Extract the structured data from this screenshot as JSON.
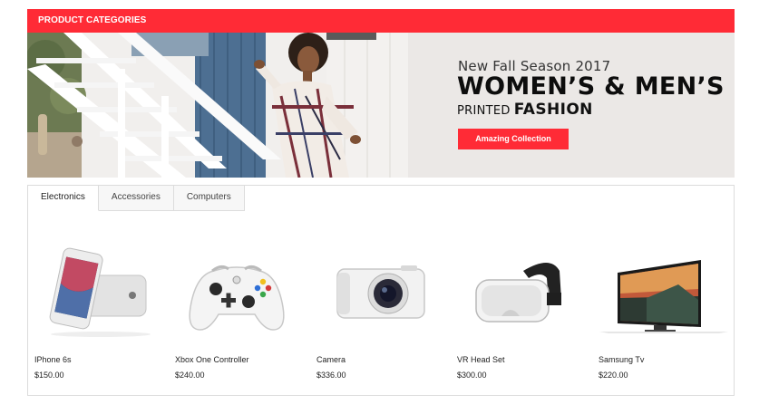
{
  "header": {
    "title": "PRODUCT CATEGORIES"
  },
  "banner": {
    "subtitle": "New Fall Season 2017",
    "title": "WOMEN’S & MEN’S",
    "printed": "PRINTED",
    "fashion": "FASHION",
    "cta_label": "Amazing Collection"
  },
  "tabs": [
    {
      "label": "Electronics",
      "active": true
    },
    {
      "label": "Accessories",
      "active": false
    },
    {
      "label": "Computers",
      "active": false
    }
  ],
  "products": [
    {
      "name": "IPhone 6s",
      "price": "$150.00",
      "icon": "phone-icon"
    },
    {
      "name": "Xbox One Controller",
      "price": "$240.00",
      "icon": "gamepad-icon"
    },
    {
      "name": "Camera",
      "price": "$336.00",
      "icon": "camera-icon"
    },
    {
      "name": "VR Head Set",
      "price": "$300.00",
      "icon": "vr-headset-icon"
    },
    {
      "name": "Samsung Tv",
      "price": "$220.00",
      "icon": "tv-icon"
    }
  ],
  "colors": {
    "accent": "#ff2b36",
    "border": "#dcdcdc"
  }
}
